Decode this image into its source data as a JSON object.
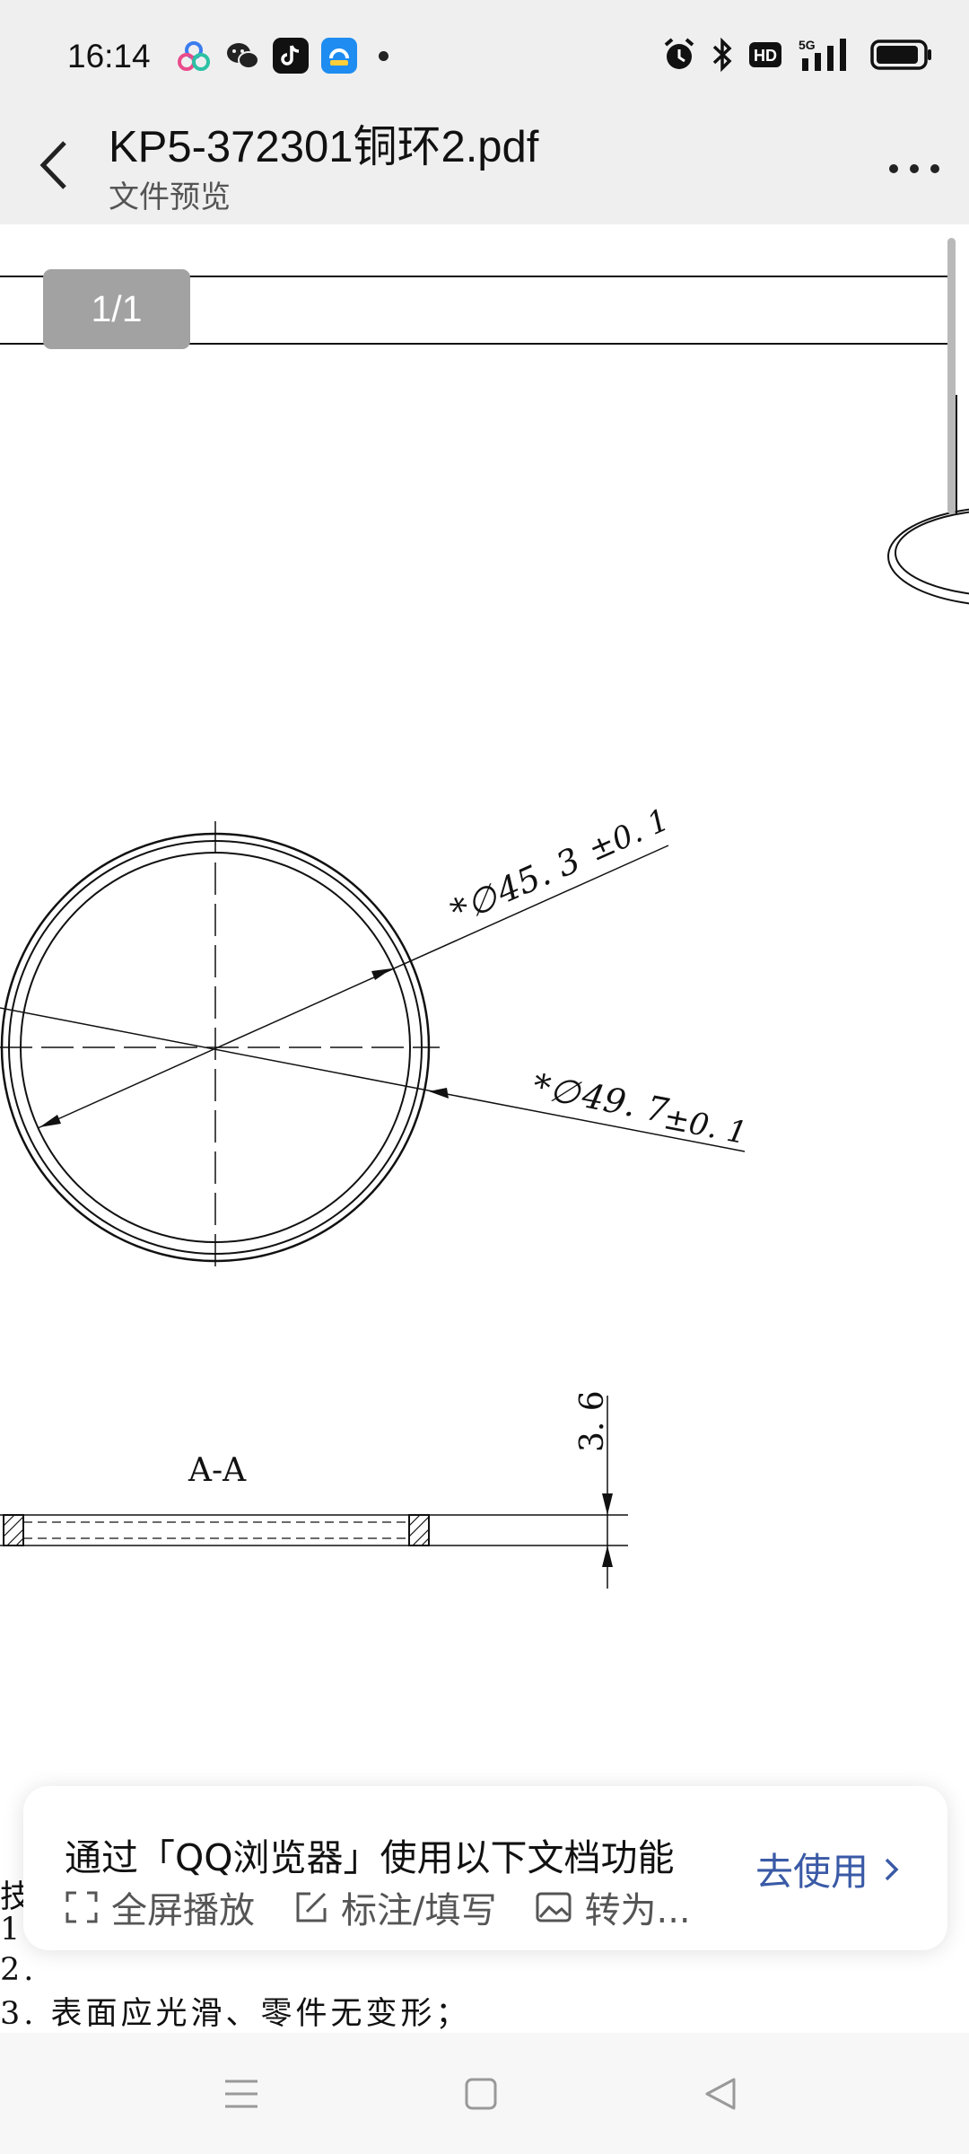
{
  "status": {
    "time": "16:14"
  },
  "header": {
    "title": "KP5-372301铜环2.pdf",
    "subtitle": "文件预览"
  },
  "viewer": {
    "page_indicator": "1/1"
  },
  "drawing": {
    "dim_inner": "45. 3",
    "dim_inner_tol": "±0. 1",
    "dim_outer": "49. 7",
    "dim_outer_tol": "±0. 1",
    "section_label": "A-A",
    "thickness": "3. 6",
    "req_line1_prefix": "技",
    "req_line2_prefix": "1",
    "req_line3_prefix": "2.",
    "req_line4": "3. 表面应光滑、零件无变形；"
  },
  "promo": {
    "title": "通过「QQ浏览器」使用以下文档功能",
    "features": [
      "全屏播放",
      "标注/填写",
      "转为..."
    ],
    "action": "去使用"
  },
  "colors": {
    "accent": "#3a5aa6",
    "bar_bg": "#efefef"
  }
}
